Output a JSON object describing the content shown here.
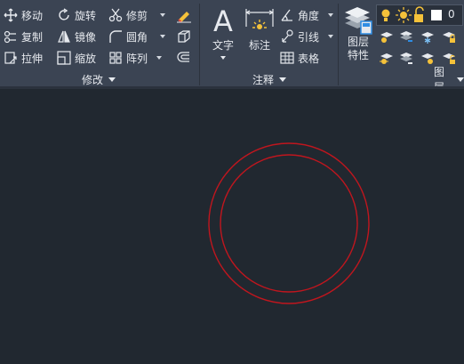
{
  "ribbon": {
    "modify": {
      "title": "修改",
      "move": "移动",
      "rotate": "旋转",
      "trim": "修剪",
      "copy": "复制",
      "mirror": "镜像",
      "fillet": "圆角",
      "stretch": "拉伸",
      "scale": "缩放",
      "array": "阵列"
    },
    "annotation": {
      "title": "注释",
      "text": "文字",
      "dimension": "标注",
      "angle": "角度",
      "leader": "引线",
      "table": "表格"
    },
    "layers": {
      "title": "图层",
      "layer_properties": "图层\n特性",
      "current_layer": "0"
    }
  },
  "canvas": {
    "circle_color": "#c0161e"
  },
  "colors": {
    "ribbon_bg": "#3b4453",
    "canvas_bg": "#212830",
    "accent_yellow": "#f5c23a",
    "accent_blue": "#2f8de4"
  }
}
